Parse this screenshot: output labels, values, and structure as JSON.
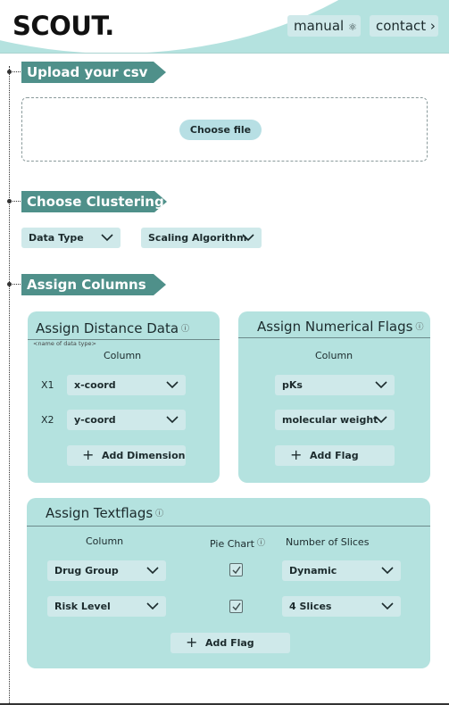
{
  "header": {
    "logo": "SCOUT.",
    "manual_label": "manual",
    "contact_label": "contact"
  },
  "sections": {
    "upload_title": "Upload your csv",
    "clustering_title": "Choose Clustering",
    "assign_title": "Assign Columns"
  },
  "upload": {
    "choose_file_label": "Choose file"
  },
  "clustering": {
    "data_type_label": "Data Type",
    "scaling_label": "Scaling Algorithm"
  },
  "distance": {
    "title": "Assign Distance Data",
    "subtitle_note": "<name of data type>",
    "column_header": "Column",
    "rows": [
      {
        "label": "X1",
        "value": "x-coord"
      },
      {
        "label": "X2",
        "value": "y-coord"
      }
    ],
    "add_label": "Add Dimension"
  },
  "numerical": {
    "title": "Assign Numerical Flags",
    "column_header": "Column",
    "rows": [
      {
        "value": "pKs"
      },
      {
        "value": "molecular weight"
      }
    ],
    "add_label": "Add Flag"
  },
  "textflags": {
    "title": "Assign Textflags",
    "column_header": "Column",
    "piechart_header": "Pie Chart",
    "slices_header": "Number of Slices",
    "rows": [
      {
        "column": "Drug Group",
        "pie_chart": true,
        "slices": "Dynamic"
      },
      {
        "column": "Risk Level",
        "pie_chart": true,
        "slices": "4 Slices"
      }
    ],
    "add_label": "Add Flag"
  },
  "icons": {
    "manual": "dna-icon",
    "contact": "chevron-right-icon",
    "dropdown": "chevron-down-icon",
    "info": "info-icon",
    "add": "plus-icon",
    "check": "checkmark-icon"
  },
  "colors": {
    "header_bg": "#b4e2df",
    "banner": "#4f908a",
    "card_bg": "#b4e2df",
    "control_bg": "#cfe9ea"
  }
}
